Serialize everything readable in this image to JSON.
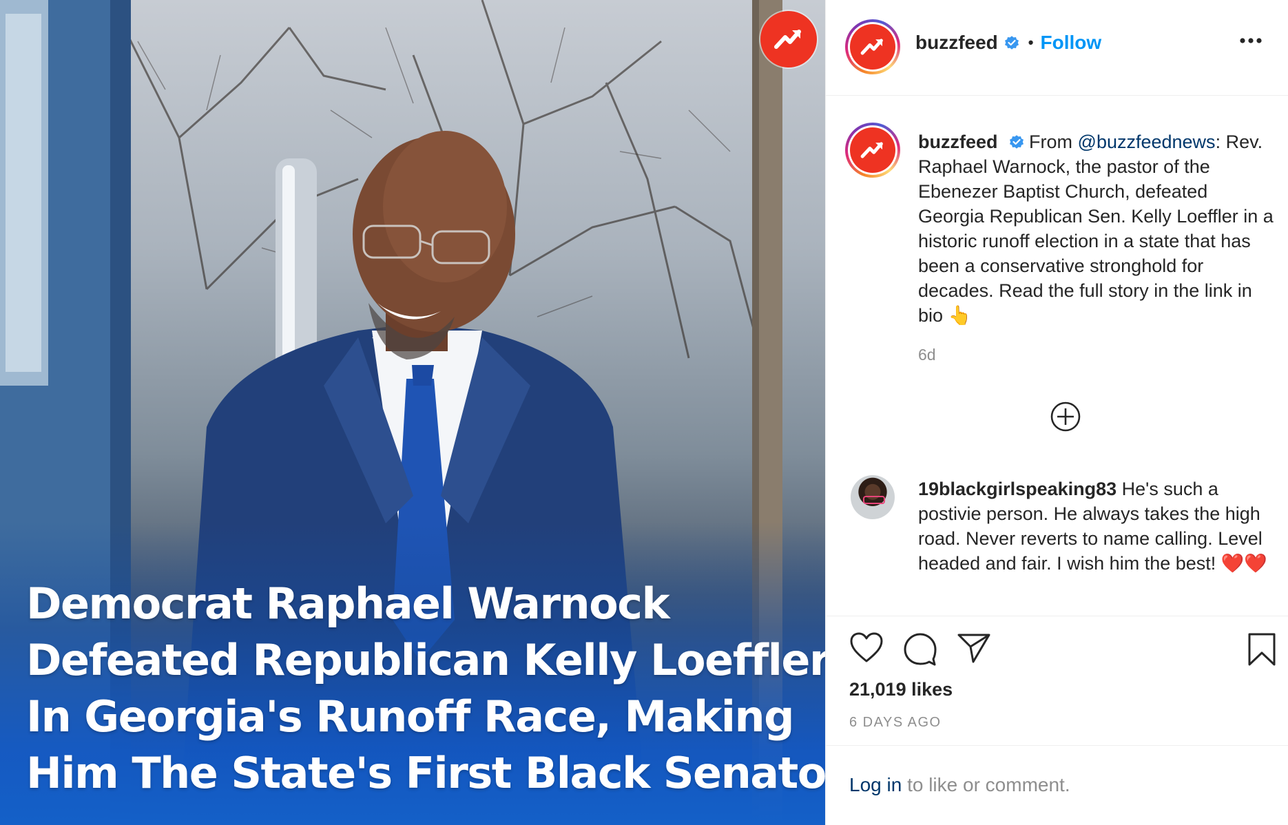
{
  "post_image": {
    "headline_lines": [
      "Democrat Raphael Warnock",
      "Defeated Republican Kelly Loeffler",
      "In Georgia's Runoff Race, Making",
      "Him The State's First Black Senator"
    ]
  },
  "header": {
    "username": "buzzfeed",
    "separator": "•",
    "follow_label": "Follow"
  },
  "caption": {
    "username": "buzzfeed",
    "prefix": "From ",
    "mention": "@buzzfeednews",
    "text": ": Rev. Raphael Warnock, the pastor of the Ebenezer Baptist Church, defeated Georgia Republican Sen. Kelly Loeffler in a historic runoff election in a state that has been a conservative stronghold for decades. Read the full story in the link in bio 👆",
    "time": "6d"
  },
  "comment": {
    "username": "19blackgirlspeaking83",
    "text": " He's such a postivie person. He always takes the high road. Never reverts to name calling. Level headed and fair. I wish him the best! ❤️❤️"
  },
  "stats": {
    "likes": "21,019 likes",
    "posted": "6 DAYS AGO"
  },
  "footer": {
    "login_label": "Log in",
    "rest": " to like or comment."
  },
  "colors": {
    "brand_red": "#ee3322",
    "link_blue": "#0095f6",
    "mention_blue": "#00376b",
    "verified_blue": "#3897f0",
    "muted_gray": "#8e8e8e"
  }
}
